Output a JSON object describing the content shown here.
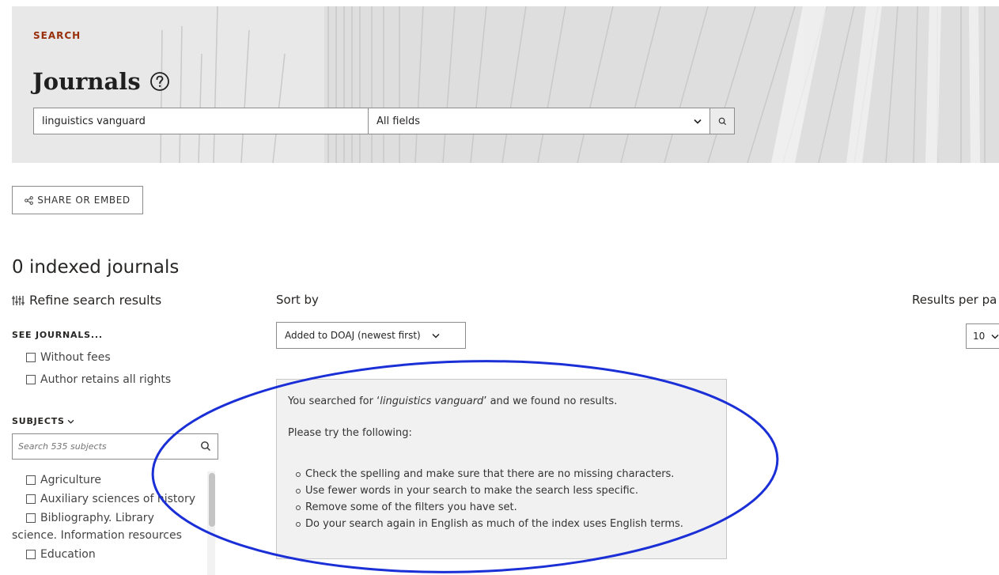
{
  "hero": {
    "kicker": "SEARCH",
    "title": "Journals",
    "search_value": "linguistics vanguard",
    "field_select": "All fields"
  },
  "share": {
    "label": "SHARE OR EMBED"
  },
  "results": {
    "count_text": "0 indexed journals"
  },
  "sidebar": {
    "refine_label": "Refine search results",
    "see_journals": {
      "heading": "SEE JOURNALS...",
      "options": [
        "Without fees",
        "Author retains all rights"
      ]
    },
    "subjects": {
      "heading": "SUBJECTS",
      "search_placeholder": "Search 535 subjects",
      "items": [
        "Agriculture",
        "Auxiliary sciences of history",
        "Bibliography. Library",
        "science. Information resources",
        "Education"
      ]
    }
  },
  "sort": {
    "label": "Sort by",
    "value": "Added to DOAJ (newest first)"
  },
  "rpp": {
    "label": "Results per pa",
    "value": "10"
  },
  "noresults": {
    "line1_pre": "You searched for ‘",
    "query": "linguistics vanguard",
    "line1_post": "’ and we found no results.",
    "line2": "Please try the following:",
    "tips": [
      "Check the spelling and make sure that there are no missing characters.",
      "Use fewer words in your search to make the search less specific.",
      "Remove some of the filters you have set.",
      "Do your search again in English as much of the index uses English terms."
    ]
  },
  "colors": {
    "accent": "#982e0a",
    "annotation": "#1a2fd6",
    "hero_bg": "#e9e9e9",
    "panel_bg": "#f2f1f1"
  }
}
